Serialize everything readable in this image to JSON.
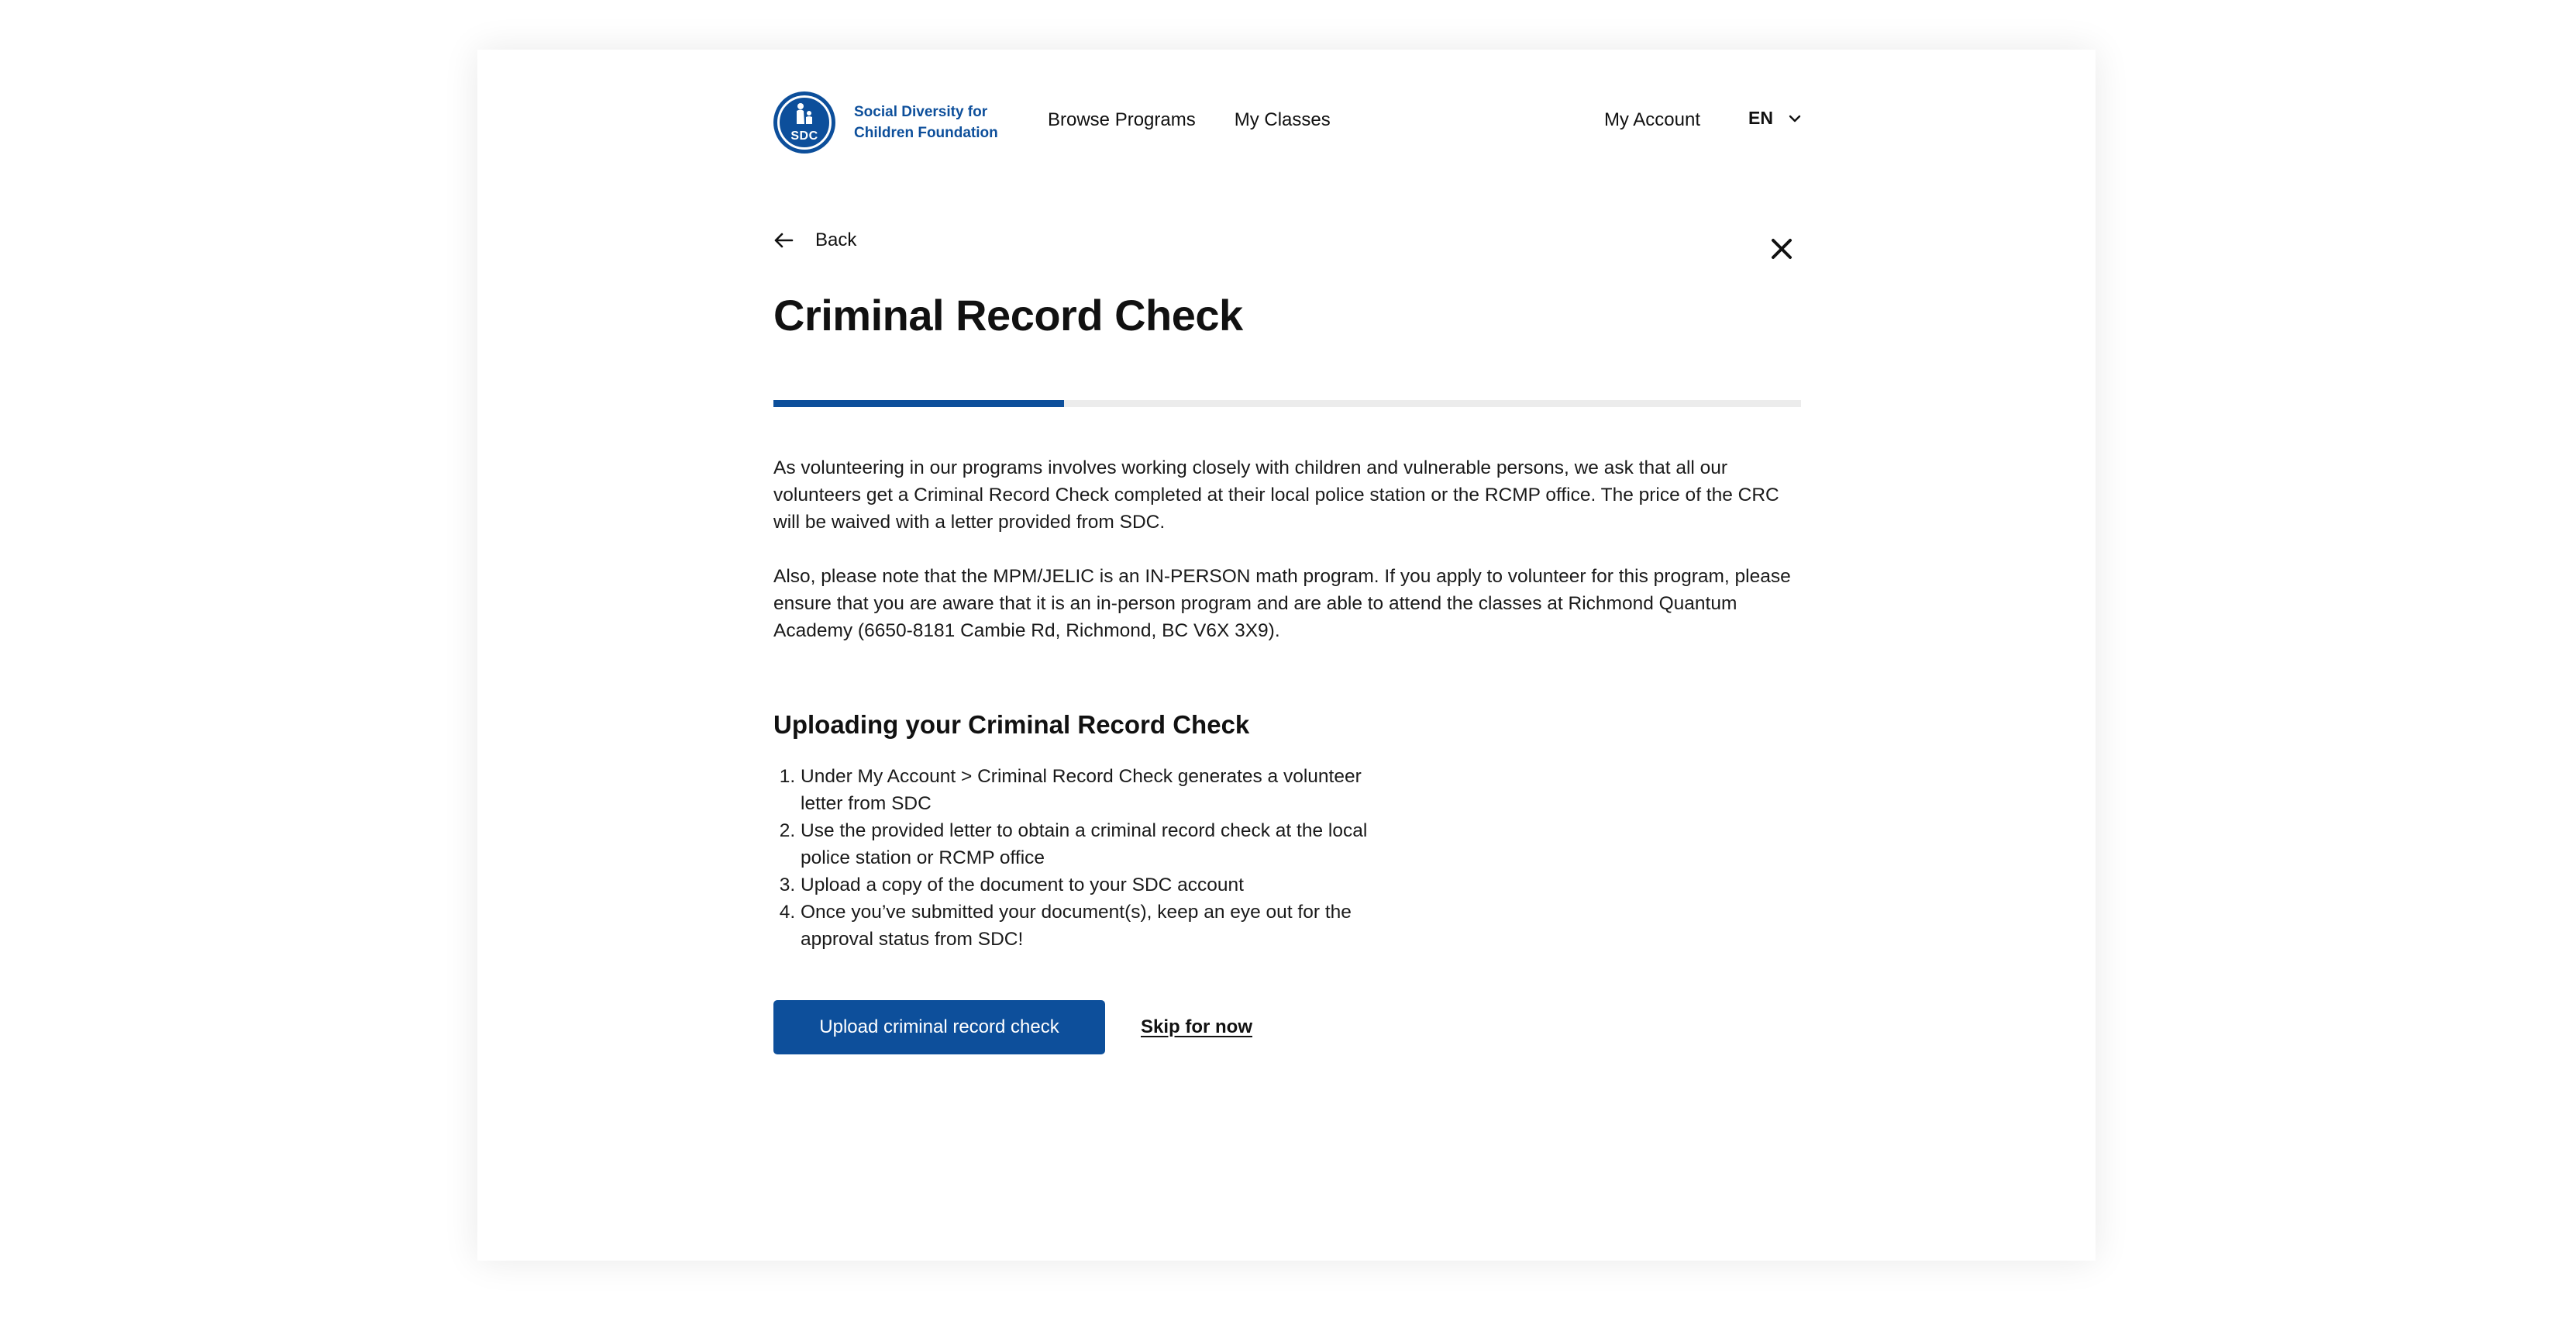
{
  "brand": {
    "logo_letters": "SDC",
    "name_line1": "Social Diversity for",
    "name_line2": "Children Foundation",
    "primary_color": "#0d4f9b"
  },
  "nav": {
    "items": [
      {
        "label": "Browse Programs"
      },
      {
        "label": "My Classes"
      }
    ],
    "account_label": "My Account",
    "language": "EN"
  },
  "page": {
    "back_label": "Back",
    "title": "Criminal Record Check",
    "progress_fraction": 0.283,
    "paragraph1": "As volunteering in our programs involves working closely with children and vulnerable persons, we ask that all our volunteers get a Criminal Record Check completed at their local police station or the RCMP office. The price of the CRC will be waived with a letter provided from SDC.",
    "paragraph2": "Also, please note that the MPM/JELIC is an IN-PERSON math program. If you apply to volunteer for this program, please ensure that you are aware that it is an in-person program and are able to attend the classes at Richmond Quantum Academy (6650-8181 Cambie Rd, Richmond, BC V6X 3X9).",
    "steps_heading": "Uploading your Criminal Record Check",
    "steps": [
      "Under My Account > Criminal Record Check generates a volunteer letter from SDC",
      "Use the provided letter to obtain a criminal record check at the local police station or RCMP office",
      "Upload a copy of the document to your SDC account",
      "Once you’ve submitted your document(s), keep an eye out for the approval status from SDC!"
    ],
    "upload_button": "Upload criminal record check",
    "skip_link": "Skip for now"
  },
  "icons": {
    "back": "arrow-left-icon",
    "close": "close-icon",
    "language_dropdown": "chevron-down-icon",
    "logo": "sdc-logo-icon"
  }
}
